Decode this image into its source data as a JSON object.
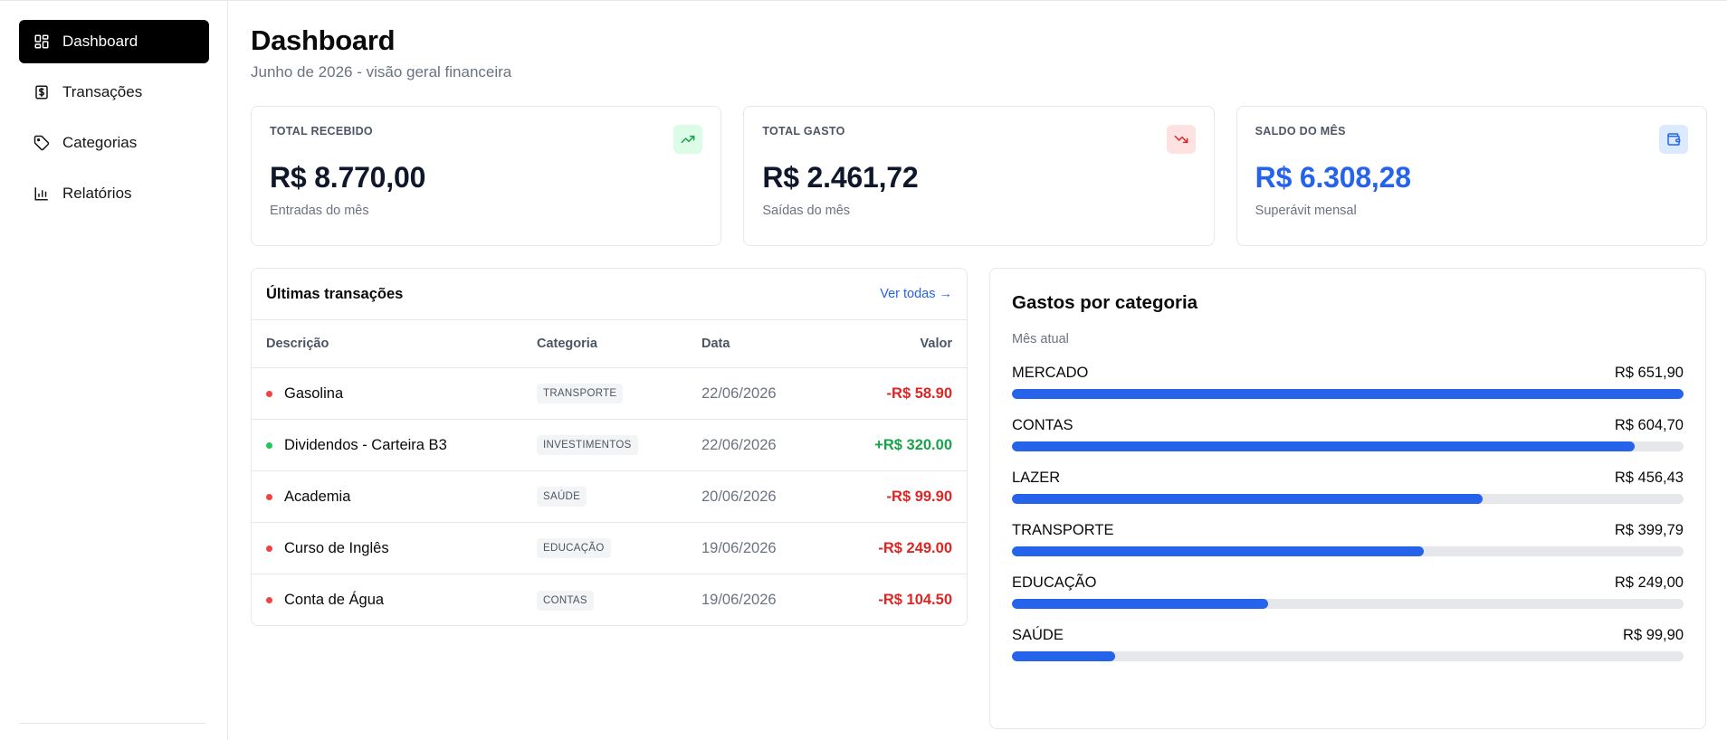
{
  "sidebar": {
    "items": [
      {
        "label": "Dashboard",
        "icon": "dashboard-icon",
        "active": true
      },
      {
        "label": "Transações",
        "icon": "dollar-square-icon",
        "active": false
      },
      {
        "label": "Categorias",
        "icon": "tag-icon",
        "active": false
      },
      {
        "label": "Relatórios",
        "icon": "bar-chart-icon",
        "active": false
      }
    ]
  },
  "header": {
    "title": "Dashboard",
    "subtitle": "Junho de 2026 - visão geral financeira"
  },
  "cards": [
    {
      "label": "TOTAL RECEBIDO",
      "value": "R$ 8.770,00",
      "desc": "Entradas do mês",
      "icon": "trending-up-icon",
      "color": "#16a34a"
    },
    {
      "label": "TOTAL GASTO",
      "value": "R$ 2.461,72",
      "desc": "Saídas do mês",
      "icon": "trending-down-icon",
      "color": "#dc2626"
    },
    {
      "label": "SALDO DO MÊS",
      "value": "R$ 6.308,28",
      "desc": "Superávit mensal",
      "icon": "wallet-icon",
      "color": "#2563eb"
    }
  ],
  "transactions": {
    "title": "Últimas transações",
    "link": "Ver todas →",
    "columns": {
      "desc": "Descrição",
      "cat": "Categoria",
      "date": "Data",
      "val": "Valor"
    },
    "rows": [
      {
        "desc": "Gasolina",
        "cat": "TRANSPORTE",
        "date": "22/06/2026",
        "val": "-R$ 58.90",
        "type": "expense"
      },
      {
        "desc": "Dividendos - Carteira B3",
        "cat": "INVESTIMENTOS",
        "date": "22/06/2026",
        "val": "+R$ 320.00",
        "type": "income"
      },
      {
        "desc": "Academia",
        "cat": "SAÚDE",
        "date": "20/06/2026",
        "val": "-R$ 99.90",
        "type": "expense"
      },
      {
        "desc": "Curso de Inglês",
        "cat": "EDUCAÇÃO",
        "date": "19/06/2026",
        "val": "-R$ 249.00",
        "type": "expense"
      },
      {
        "desc": "Conta de Água",
        "cat": "CONTAS",
        "date": "19/06/2026",
        "val": "-R$ 104.50",
        "type": "expense"
      }
    ]
  },
  "categories": {
    "title": "Gastos por categoria",
    "subtitle": "Mês atual",
    "items": [
      {
        "name": "MERCADO",
        "amount": "R$ 651,90",
        "value": 651.9
      },
      {
        "name": "CONTAS",
        "amount": "R$ 604,70",
        "value": 604.7
      },
      {
        "name": "LAZER",
        "amount": "R$ 456,43",
        "value": 456.43
      },
      {
        "name": "TRANSPORTE",
        "amount": "R$ 399,79",
        "value": 399.79
      },
      {
        "name": "EDUCAÇÃO",
        "amount": "R$ 249,00",
        "value": 249.0
      },
      {
        "name": "SAÚDE",
        "amount": "R$ 99,90",
        "value": 99.9
      }
    ]
  }
}
